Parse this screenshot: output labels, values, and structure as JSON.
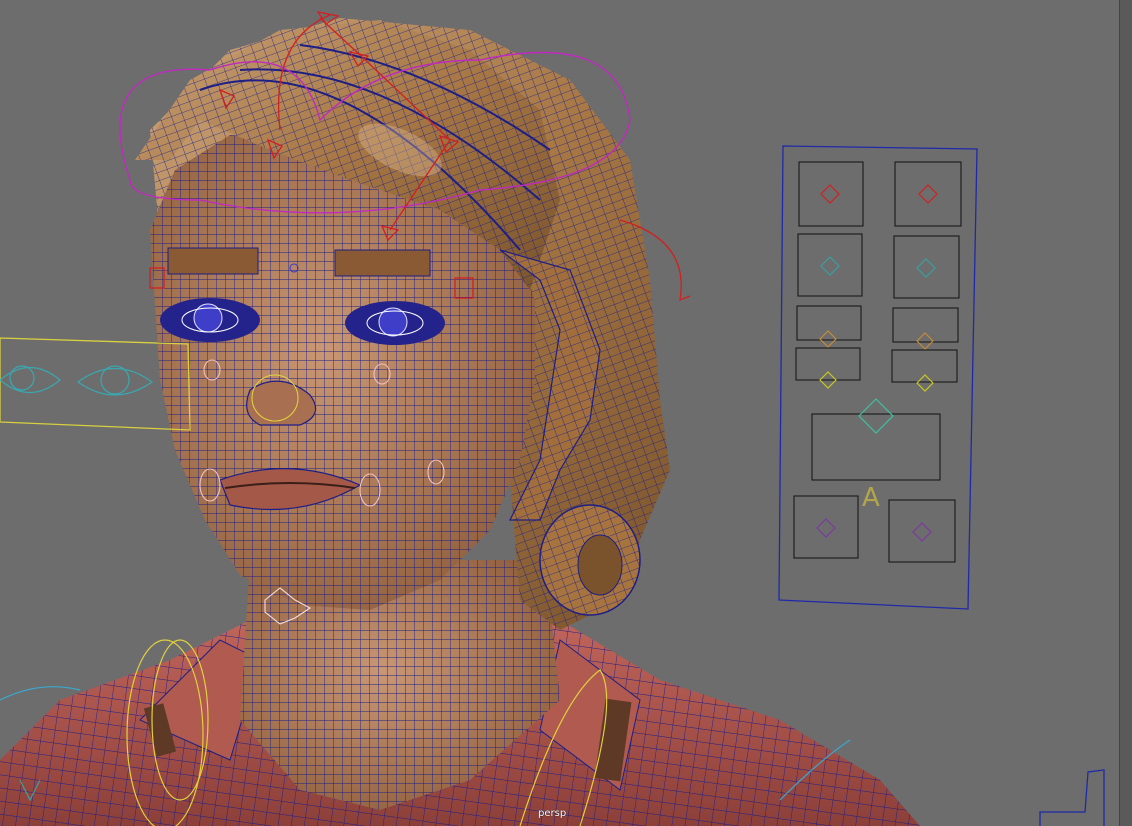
{
  "viewport": {
    "camera_label": "persp",
    "background_color": "#6d6d6d"
  },
  "face_control_panel": {
    "letter_label": "A",
    "frame_color": "#1f2aa8",
    "controls": [
      {
        "name": "brow-left",
        "color": "#d22020"
      },
      {
        "name": "brow-right",
        "color": "#d22020"
      },
      {
        "name": "eye-left",
        "color": "#3aa0a0"
      },
      {
        "name": "eye-right",
        "color": "#3aa0a0"
      },
      {
        "name": "cheek-left",
        "color": "#c48a3a"
      },
      {
        "name": "cheek-right",
        "color": "#c48a3a"
      },
      {
        "name": "mouth-corner-left",
        "color": "#c8c820"
      },
      {
        "name": "mouth-corner-right",
        "color": "#c8c820"
      },
      {
        "name": "jaw",
        "color": "#40c0a0"
      },
      {
        "name": "chin-left",
        "color": "#7a3aa0"
      },
      {
        "name": "chin-right",
        "color": "#7a3aa0"
      }
    ]
  },
  "rig_colors": {
    "mesh_wire": "#1a1a8a",
    "skin": "#b5805a",
    "hair": "#a8733e",
    "shirt": "#b2574e",
    "head_curve": "#c02ac0",
    "hair_control": "#d22020",
    "eye_aim": "#d8d040",
    "eye_aim_icon": "#3aa8b0"
  }
}
